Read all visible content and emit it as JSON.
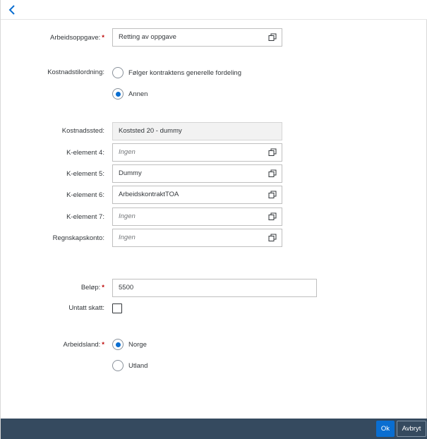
{
  "header": {
    "back_icon": "chevron-left-icon"
  },
  "form": {
    "arbeidsoppgave": {
      "label": "Arbeidsoppgave:",
      "required": "*",
      "value": "Retting av oppgave"
    },
    "kostnadstilordning": {
      "label": "Kostnadstilordning:",
      "options": [
        {
          "label": "Følger kontraktens generelle fordeling",
          "selected": false
        },
        {
          "label": "Annen",
          "selected": true
        }
      ]
    },
    "kostnadssted": {
      "label": "Kostnadssted:",
      "value": "Koststed 20 - dummy"
    },
    "k_element_4": {
      "label": "K-element 4:",
      "placeholder": "Ingen"
    },
    "k_element_5": {
      "label": "K-element 5:",
      "value": "Dummy"
    },
    "k_element_6": {
      "label": "K-element 6:",
      "value": "ArbeidskontraktTOA"
    },
    "k_element_7": {
      "label": "K-element 7:",
      "placeholder": "Ingen"
    },
    "regnskapskonto": {
      "label": "Regnskapskonto:",
      "placeholder": "Ingen"
    },
    "belop": {
      "label": "Beløp:",
      "required": "*",
      "value": "5500"
    },
    "untatt_skatt": {
      "label": "Untatt skatt:",
      "checked": false
    },
    "arbeidsland": {
      "label": "Arbeidsland:",
      "required": "*",
      "options": [
        {
          "label": "Norge",
          "selected": true
        },
        {
          "label": "Utland",
          "selected": false
        }
      ]
    }
  },
  "footer": {
    "ok_label": "Ok",
    "cancel_label": "Avbryt"
  },
  "colors": {
    "accent": "#0a6ed1",
    "footer_bg": "#354a5f",
    "required": "#bb0000"
  }
}
